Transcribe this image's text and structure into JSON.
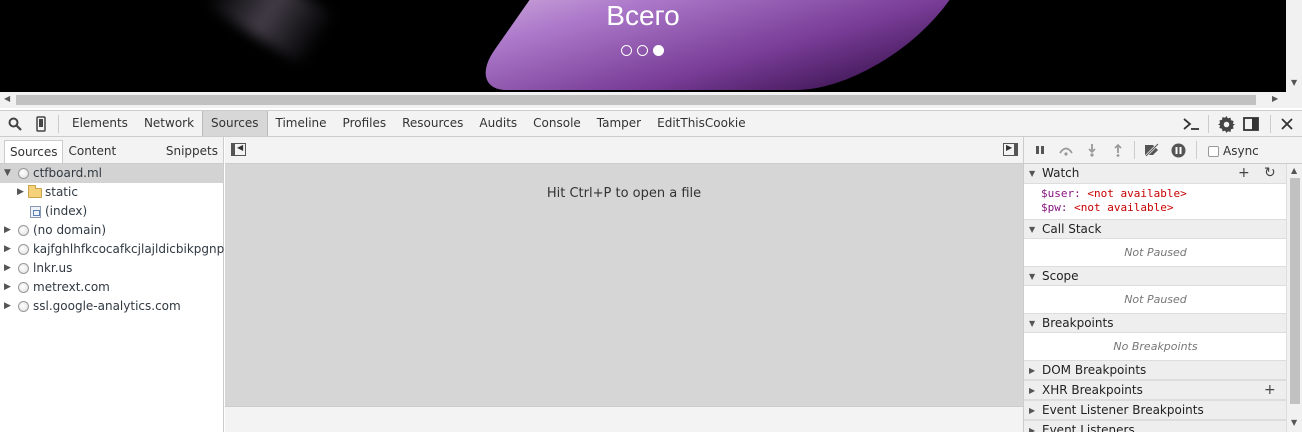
{
  "page": {
    "hero_title": "Всего",
    "carousel_dots": 3,
    "carousel_active_index": 3
  },
  "toolbar": {
    "search_icon": "search-icon",
    "device_icon": "device-mode-icon",
    "tabs": [
      "Elements",
      "Network",
      "Sources",
      "Timeline",
      "Profiles",
      "Resources",
      "Audits",
      "Console",
      "Tamper",
      "EditThisCookie"
    ],
    "selected_tab": "Sources",
    "right_icons": [
      "console-drawer-icon",
      "gear-icon",
      "dock-icon",
      "close-icon"
    ]
  },
  "navigator": {
    "tabs": [
      "Sources",
      "Content scripts",
      "Snippets"
    ],
    "selected_tab": "Sources",
    "tree": [
      {
        "label": "ctfboard.ml",
        "icon": "globe-icon",
        "expanded": true,
        "selected": true,
        "depth": 0
      },
      {
        "label": "static",
        "icon": "folder-icon",
        "expanded": false,
        "selected": false,
        "depth": 1
      },
      {
        "label": "(index)",
        "icon": "file-icon",
        "expanded": null,
        "selected": false,
        "depth": 1
      },
      {
        "label": "(no domain)",
        "icon": "globe-icon",
        "expanded": false,
        "selected": false,
        "depth": 0
      },
      {
        "label": "kajfghlhfkcocafkcjlajldicbikpgnp",
        "icon": "globe-icon",
        "expanded": false,
        "selected": false,
        "depth": 0
      },
      {
        "label": "lnkr.us",
        "icon": "globe-icon",
        "expanded": false,
        "selected": false,
        "depth": 0
      },
      {
        "label": "metrext.com",
        "icon": "globe-icon",
        "expanded": false,
        "selected": false,
        "depth": 0
      },
      {
        "label": "ssl.google-analytics.com",
        "icon": "globe-icon",
        "expanded": false,
        "selected": false,
        "depth": 0
      }
    ]
  },
  "editor": {
    "hint": "Hit Ctrl+P to open a file"
  },
  "debugger": {
    "async_label": "Async",
    "async_checked": false,
    "sections": {
      "watch": {
        "title": "Watch",
        "entries": [
          {
            "name": "$user",
            "value": "<not available>"
          },
          {
            "name": "$pw",
            "value": "<not available>"
          }
        ]
      },
      "call_stack": {
        "title": "Call Stack",
        "info": "Not Paused"
      },
      "scope": {
        "title": "Scope",
        "info": "Not Paused"
      },
      "breakpoints": {
        "title": "Breakpoints",
        "info": "No Breakpoints"
      },
      "dom_breakpoints": {
        "title": "DOM Breakpoints"
      },
      "xhr_breakpoints": {
        "title": "XHR Breakpoints"
      },
      "event_listener_breakpoints": {
        "title": "Event Listener Breakpoints"
      },
      "event_listeners": {
        "title": "Event Listeners"
      }
    }
  }
}
